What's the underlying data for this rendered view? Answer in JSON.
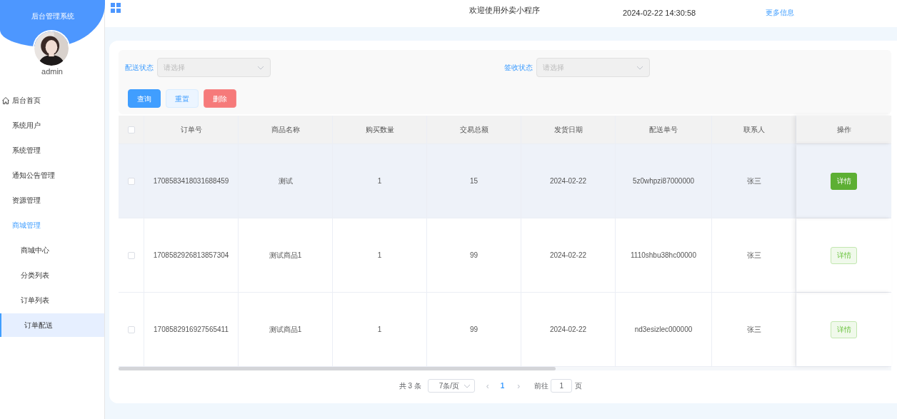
{
  "sidebar": {
    "title": "后台管理系统",
    "user": {
      "name": "admin"
    },
    "items": [
      {
        "label": "后台首页",
        "selected": false,
        "kind": "home"
      },
      {
        "label": "系统用户",
        "selected": false
      },
      {
        "label": "系统管理",
        "selected": false
      },
      {
        "label": "通知公告管理",
        "selected": false
      },
      {
        "label": "资源管理",
        "selected": false
      },
      {
        "label": "商城管理",
        "selected": false,
        "expanded": true,
        "children": [
          {
            "label": "商城中心",
            "selected": false
          },
          {
            "label": "分类列表",
            "selected": false
          },
          {
            "label": "订单列表",
            "selected": false
          },
          {
            "label": "订单配送",
            "selected": true
          }
        ]
      }
    ]
  },
  "header": {
    "title": "欢迎使用外卖小程序",
    "datetime": "2024-02-22 14:30:58",
    "more_link": "更多信息"
  },
  "filters": [
    {
      "label": "配送状态",
      "placeholder": "请选择"
    },
    {
      "label": "签收状态",
      "placeholder": "请选择"
    }
  ],
  "buttons": [
    {
      "label": "查询",
      "kind": "primary"
    },
    {
      "label": "重置",
      "kind": "plain"
    },
    {
      "label": "删除",
      "kind": "danger"
    }
  ],
  "table": {
    "select_all_checked": false,
    "columns": [
      "订单号",
      "商品名称",
      "购买数量",
      "交易总额",
      "发货日期",
      "配送单号",
      "联系人",
      "操作"
    ],
    "rows": [
      {
        "checked": false,
        "highlighted": true,
        "cells": [
          "1708583418031688459",
          "测试",
          "1",
          "15",
          "2024-02-22",
          "5z0whpzi87000000",
          "张三"
        ],
        "action": {
          "label": "详情",
          "hovered": true
        }
      },
      {
        "checked": false,
        "highlighted": false,
        "cells": [
          "1708582926813857304",
          "测试商品1",
          "1",
          "99",
          "2024-02-22",
          "1110shbu38hc00000",
          "张三"
        ],
        "action": {
          "label": "详情",
          "hovered": false
        }
      },
      {
        "checked": false,
        "highlighted": false,
        "cells": [
          "1708582916927565411",
          "测试商品1",
          "1",
          "99",
          "2024-02-22",
          "nd3esizlec000000",
          "张三"
        ],
        "action": {
          "label": "详情",
          "hovered": false
        }
      }
    ]
  },
  "pagination": {
    "total": "共 3 条",
    "page_size": "7条/页",
    "prev": "‹",
    "pages": [
      {
        "label": "1",
        "selected": true
      }
    ],
    "next": "›",
    "goto_label": "前往",
    "goto_value": "1",
    "goto_suffix": "页"
  }
}
